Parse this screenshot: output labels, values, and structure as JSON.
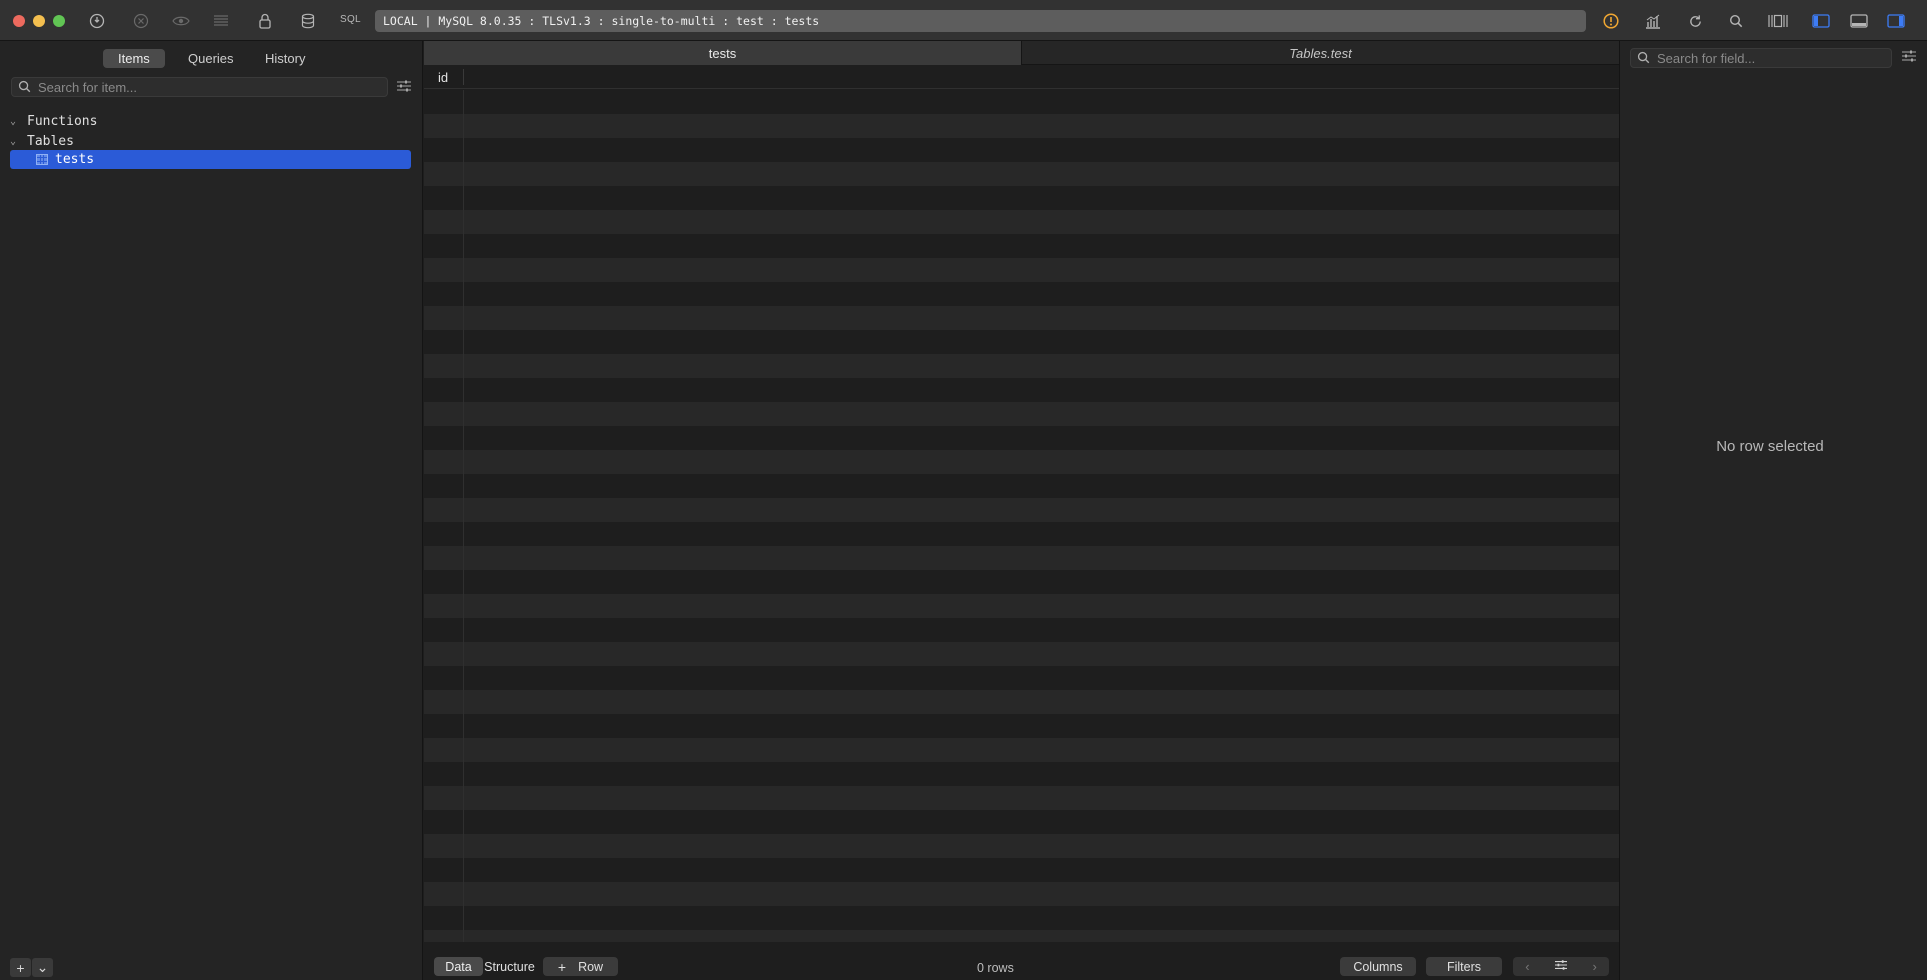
{
  "toolbar": {
    "sql_label": "SQL",
    "connection": "LOCAL | MySQL 8.0.35 : TLSv1.3 : single-to-multi : test : tests"
  },
  "sidebar": {
    "segments": [
      "Items",
      "Queries",
      "History"
    ],
    "active_segment": "Items",
    "search_placeholder": "Search for item...",
    "tree": {
      "functions_label": "Functions",
      "tables_label": "Tables",
      "selected_item": "tests"
    },
    "bottom_add": "+",
    "bottom_menu": "⌄"
  },
  "main": {
    "tabs": [
      {
        "label": "tests",
        "active": true
      },
      {
        "label": "Tables.test",
        "active": false
      }
    ],
    "columns": [
      "id"
    ],
    "bottom": {
      "data_label": "Data",
      "structure_label": "Structure",
      "add_row_label": "Row",
      "row_count": "0 rows",
      "columns_label": "Columns",
      "filters_label": "Filters"
    }
  },
  "right_panel": {
    "search_placeholder": "Search for field...",
    "empty_message": "No row selected"
  },
  "colors": {
    "selection": "#2b5bd7",
    "warning": "#f0a732"
  }
}
